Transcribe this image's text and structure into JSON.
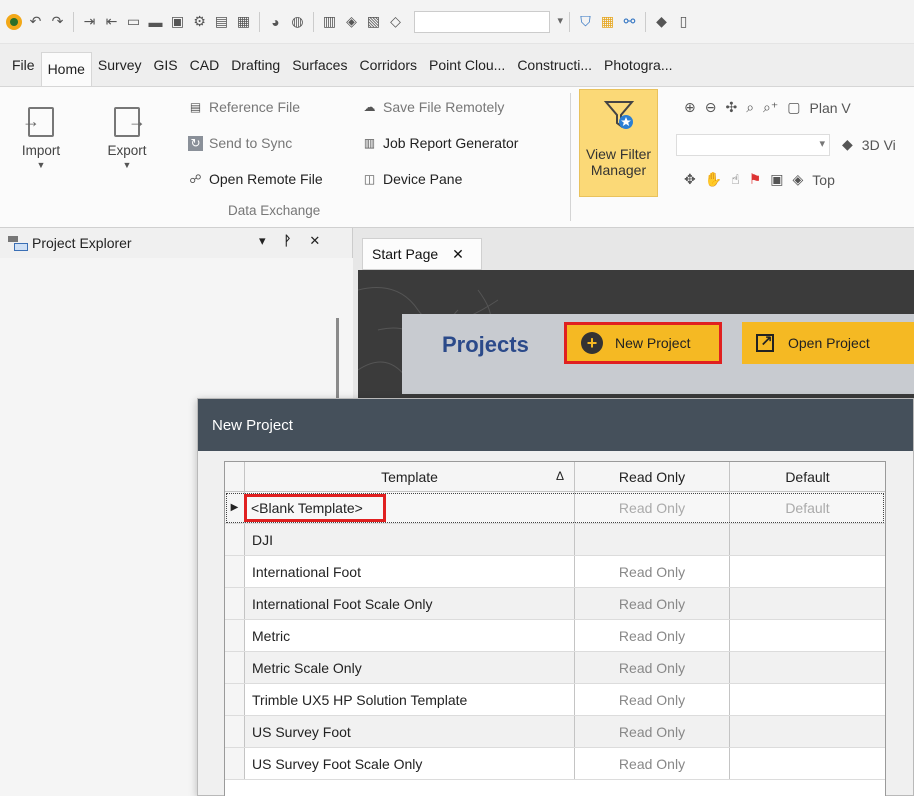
{
  "qat": {
    "icons": [
      "app-logo-icon",
      "undo-icon",
      "redo-icon",
      "import-icon",
      "export-icon",
      "new-icon",
      "open-folder-icon",
      "save-icon",
      "settings-icon",
      "layout-icon",
      "monitor-icon",
      "helmet-icon",
      "globe-icon",
      "grid-icon",
      "cube-icon",
      "image-icon",
      "eye-icon"
    ],
    "combo_value": "",
    "right_icons": [
      "filter-icon",
      "layers-icon",
      "group-icon",
      "cube-view-icon",
      "page-icon"
    ]
  },
  "menu": {
    "tabs": [
      "File",
      "Home",
      "Survey",
      "GIS",
      "CAD",
      "Drafting",
      "Surfaces",
      "Corridors",
      "Point Clou...",
      "Constructi...",
      "Photogra..."
    ],
    "active": "Home"
  },
  "ribbon": {
    "import_label": "Import",
    "export_label": "Export",
    "reference_file": "Reference File",
    "send_to_sync": "Send to Sync",
    "open_remote_file": "Open Remote File",
    "save_file_remotely": "Save File Remotely",
    "job_report_generator": "Job Report Generator",
    "device_pane": "Device Pane",
    "group_label": "Data Exchange",
    "view_filter_line1": "View Filter",
    "view_filter_line2": "Manager",
    "plan_view": "Plan V",
    "view_3d": "3D Vi",
    "top_view": "Top"
  },
  "explorer": {
    "title": "Project Explorer",
    "dropdown_glyph": "▾",
    "pin_glyph": "ᚹ",
    "close_glyph": "✕"
  },
  "doc": {
    "tab_label": "Start Page",
    "tab_close": "✕",
    "projects_title": "Projects",
    "new_project": "New Project",
    "open_project": "Open Project"
  },
  "dialog": {
    "title": "New Project",
    "columns": {
      "template": "Template",
      "sort_glyph": "Δ",
      "read_only": "Read Only",
      "default": "Default"
    },
    "rows": [
      {
        "template": "<Blank Template>",
        "read_only": "Read Only",
        "default": "Default"
      },
      {
        "template": "DJI",
        "read_only": "",
        "default": ""
      },
      {
        "template": "International Foot",
        "read_only": "Read Only",
        "default": ""
      },
      {
        "template": "International Foot Scale Only",
        "read_only": "Read Only",
        "default": ""
      },
      {
        "template": "Metric",
        "read_only": "Read Only",
        "default": ""
      },
      {
        "template": "Metric Scale Only",
        "read_only": "Read Only",
        "default": ""
      },
      {
        "template": "Trimble UX5 HP Solution Template",
        "read_only": "Read Only",
        "default": ""
      },
      {
        "template": "US Survey Foot",
        "read_only": "Read Only",
        "default": ""
      },
      {
        "template": "US Survey Foot Scale Only",
        "read_only": "Read Only",
        "default": ""
      }
    ],
    "row_pointer_glyph": "▶"
  },
  "colors": {
    "accent_yellow": "#f5b923",
    "highlight_red": "#e02020",
    "dialog_title_bg": "#45505b",
    "projects_blue": "#2b4a8a"
  }
}
